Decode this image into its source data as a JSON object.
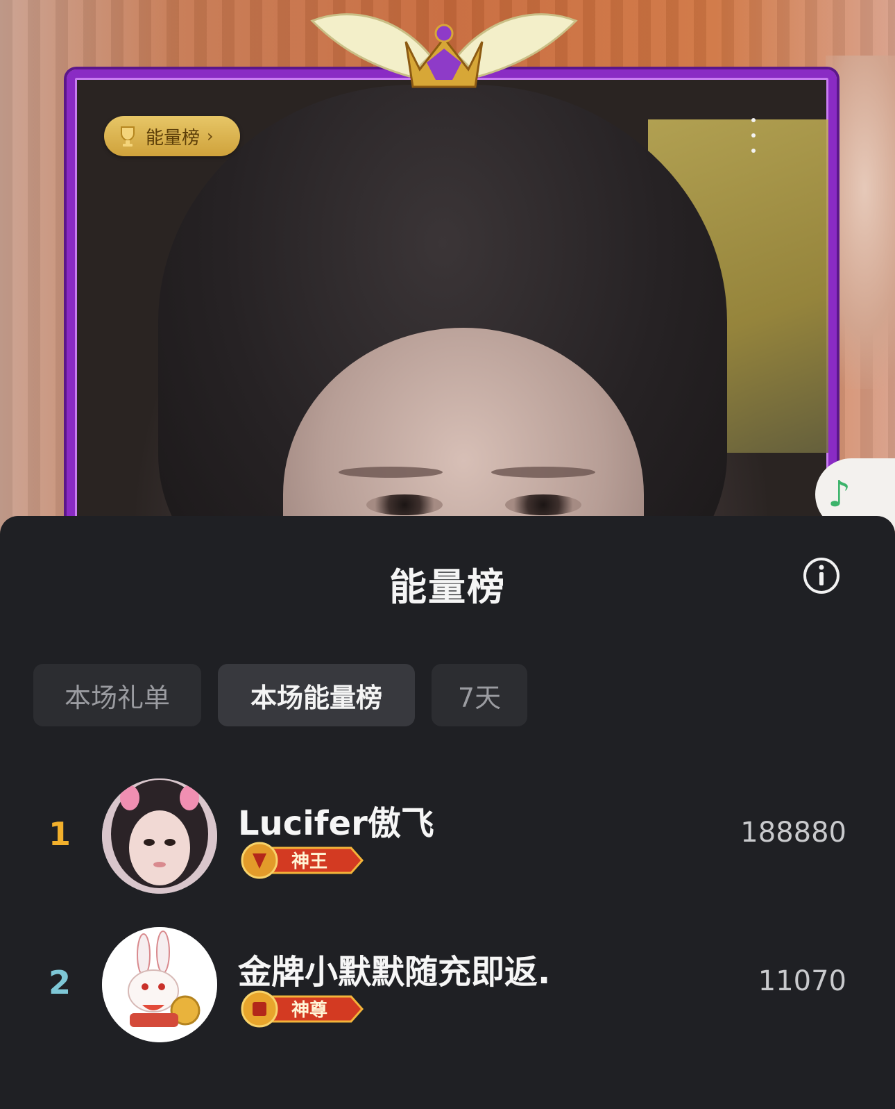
{
  "stage": {
    "energy_chip_label": "能量榜",
    "energy_chip_chevron": "›",
    "more_icon": "more-vertical-icon",
    "music_icon": "♪",
    "frame_color": "#8a2bc4"
  },
  "sheet": {
    "title": "能量榜",
    "info_icon": "info-icon",
    "tabs": [
      {
        "label": "本场礼单",
        "active": false
      },
      {
        "label": "本场能量榜",
        "active": true
      },
      {
        "label": "7天",
        "active": false
      }
    ],
    "rows": [
      {
        "rank": "1",
        "name": "Lucifer傲飞",
        "badge": "神王",
        "score": "188880",
        "rank_color": "#f2b02c"
      },
      {
        "rank": "2",
        "name": "金牌小默默随充即返.",
        "badge": "神尊",
        "score": "11070",
        "rank_color": "#7ec7d6"
      }
    ]
  }
}
